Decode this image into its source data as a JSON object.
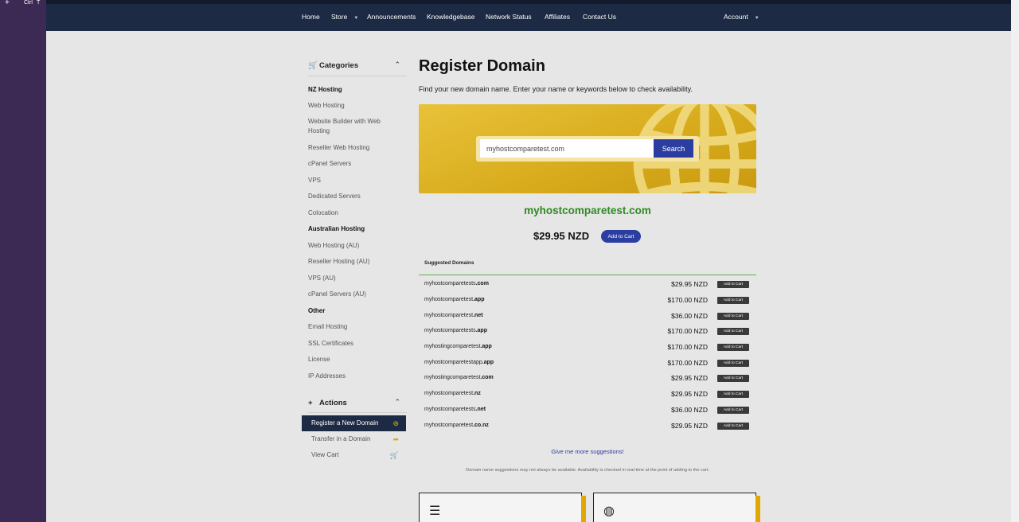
{
  "os": {
    "plus": "+",
    "ctrl": "Ctrl",
    "t": "T"
  },
  "nav": {
    "home": "Home",
    "store": "Store",
    "announcements": "Announcements",
    "knowledgebase": "Knowledgebase",
    "network_status": "Network Status",
    "affiliates": "Affiliates",
    "contact": "Contact Us",
    "account": "Account"
  },
  "sidebar": {
    "categories_title": "Categories",
    "items": [
      {
        "label": "NZ Hosting",
        "bold": true
      },
      {
        "label": "Web Hosting"
      },
      {
        "label": "Website Builder with Web Hosting"
      },
      {
        "label": "Reseller Web Hosting"
      },
      {
        "label": "cPanel Servers"
      },
      {
        "label": "VPS"
      },
      {
        "label": "Dedicated Servers"
      },
      {
        "label": "Colocation"
      },
      {
        "label": "Australian Hosting",
        "bold": true
      },
      {
        "label": "Web Hosting (AU)"
      },
      {
        "label": "Reseller Hosting (AU)"
      },
      {
        "label": "VPS (AU)"
      },
      {
        "label": "cPanel Servers (AU)"
      },
      {
        "label": "Other",
        "bold": true
      },
      {
        "label": "Email Hosting"
      },
      {
        "label": "SSL Certificates"
      },
      {
        "label": "License"
      },
      {
        "label": "IP Addresses"
      }
    ],
    "actions_title": "Actions",
    "actions": [
      {
        "label": "Register a New Domain",
        "icon": "globe-icon"
      },
      {
        "label": "Transfer in a Domain",
        "icon": "share-arrow-icon"
      },
      {
        "label": "View Cart",
        "icon": "cart-icon"
      }
    ]
  },
  "main": {
    "title": "Register Domain",
    "subtitle": "Find your new domain name. Enter your name or keywords below to check availability.",
    "search_value": "myhostcomparetest.com",
    "search_label": "Search",
    "result_domain": "myhostcomparetest.com",
    "result_price": "$29.95 NZD",
    "add_to_cart": "Add to Cart",
    "suggested_title": "Suggested Domains",
    "suggestions": [
      {
        "name": "myhostcomparetests",
        "tld": ".com",
        "price": "$29.95 NZD"
      },
      {
        "name": "myhostcomparetest",
        "tld": ".app",
        "price": "$170.00 NZD"
      },
      {
        "name": "myhostcomparetest",
        "tld": ".net",
        "price": "$36.00 NZD"
      },
      {
        "name": "myhostcomparetests",
        "tld": ".app",
        "price": "$170.00 NZD"
      },
      {
        "name": "myhostingcomparetest",
        "tld": ".app",
        "price": "$170.00 NZD"
      },
      {
        "name": "myhostcomparetestapp",
        "tld": ".app",
        "price": "$170.00 NZD"
      },
      {
        "name": "myhostingcomparetest",
        "tld": ".com",
        "price": "$29.95 NZD"
      },
      {
        "name": "myhostcomparetest",
        "tld": ".nz",
        "price": "$29.95 NZD"
      },
      {
        "name": "myhostcomparetests",
        "tld": ".net",
        "price": "$36.00 NZD"
      },
      {
        "name": "myhostcomparetest",
        "tld": ".co.nz",
        "price": "$29.95 NZD"
      }
    ],
    "more_suggestions": "Give me more suggestions!",
    "note": "Domain name suggestions may not always be available. Availability is checked in real-time at the point of adding to the cart."
  },
  "colors": {
    "navbar": "#1c2a44",
    "accent_blue": "#2b3da0",
    "domain_green": "#2f8a23",
    "banner_gold": "#d8ac1d",
    "icon_gold": "#e0a800"
  }
}
